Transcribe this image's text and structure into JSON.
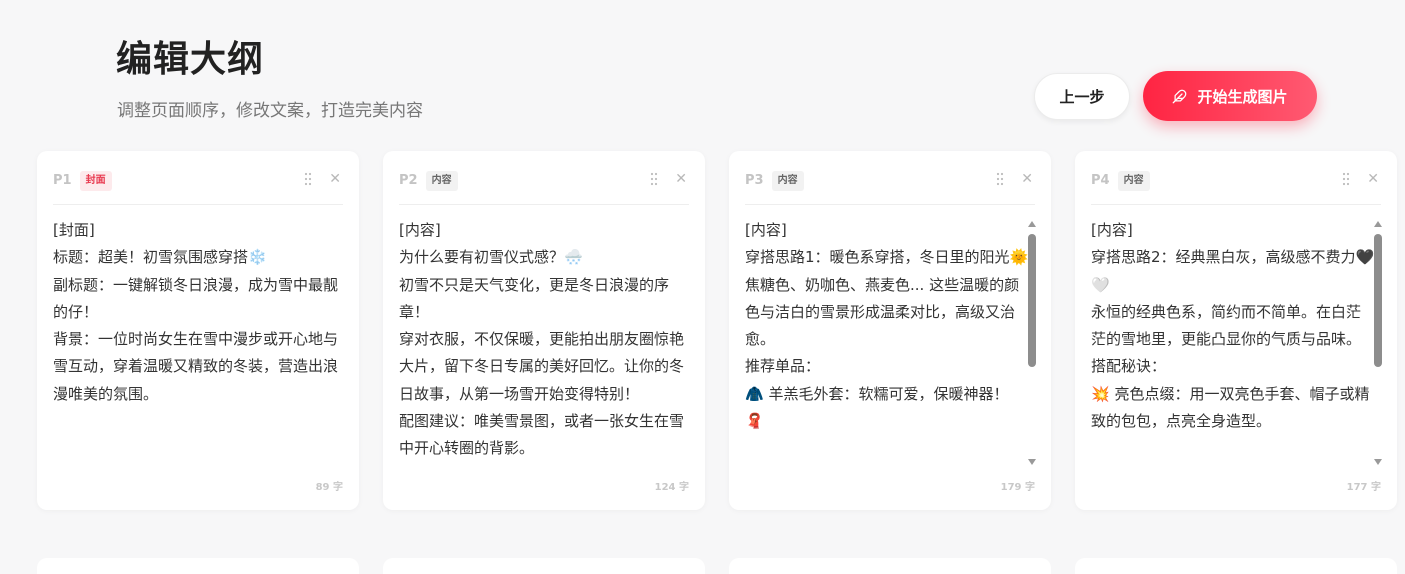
{
  "header": {
    "title": "编辑大纲",
    "subtitle": "调整页面顺序，修改文案，打造完美内容"
  },
  "actions": {
    "prev_label": "上一步",
    "generate_label": "开始生成图片",
    "generate_icon": "feather-icon"
  },
  "colors": {
    "accent": "#ff2442",
    "cover_tag_bg": "#fdeaec",
    "cover_tag_text": "#e8394f"
  },
  "cards": [
    {
      "page": "P1",
      "tag": "封面",
      "lines": [
        "[封面]",
        "标题：超美！初雪氛围感穿搭❄️",
        "副标题：一键解锁冬日浪漫，成为雪中最靓的仔！",
        "背景：一位时尚女生在雪中漫步或开心地与雪互动，穿着温暖又精致的冬装，营造出浪漫唯美的氛围。"
      ],
      "word_count": "89 字"
    },
    {
      "page": "P2",
      "tag": "内容",
      "lines": [
        "[内容]",
        "为什么要有初雪仪式感？🌨️",
        "初雪不只是天气变化，更是冬日浪漫的序章！",
        "穿对衣服，不仅保暖，更能拍出朋友圈惊艳大片，留下冬日专属的美好回忆。让你的冬日故事，从第一场雪开始变得特别！",
        "配图建议：唯美雪景图，或者一张女生在雪中开心转圈的背影。"
      ],
      "word_count": "124 字"
    },
    {
      "page": "P3",
      "tag": "内容",
      "lines": [
        "[内容]",
        "穿搭思路1：暖色系穿搭，冬日里的阳光🌞",
        "焦糖色、奶咖色、燕麦色... 这些温暖的颜色与洁白的雪景形成温柔对比，高级又治愈。",
        "推荐单品：",
        "🧥 羊羔毛外套：软糯可爱，保暖神器！",
        "🧣"
      ],
      "word_count": "179 字"
    },
    {
      "page": "P4",
      "tag": "内容",
      "lines": [
        "[内容]",
        "穿搭思路2：经典黑白灰，高级感不费力🖤🤍",
        "永恒的经典色系，简约而不简单。在白茫茫的雪地里，更能凸显你的气质与品味。",
        "搭配秘诀：",
        "💥 亮色点缀：用一双亮色手套、帽子或精致的包包，点亮全身造型。"
      ],
      "word_count": "177 字"
    }
  ]
}
